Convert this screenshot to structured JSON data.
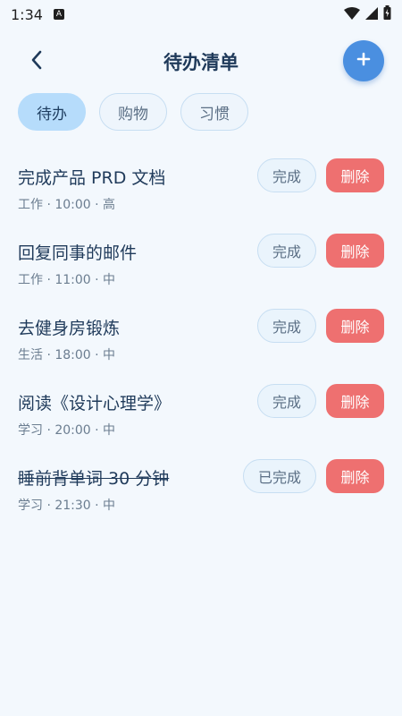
{
  "status_bar": {
    "time": "1:34",
    "notification_icon": "A"
  },
  "header": {
    "title": "待办清单",
    "back_icon": "chevron-left",
    "add_icon": "plus"
  },
  "tabs": [
    {
      "label": "待办",
      "active": true
    },
    {
      "label": "购物",
      "active": false
    },
    {
      "label": "习惯",
      "active": false
    }
  ],
  "tasks": [
    {
      "title": "完成产品 PRD 文档",
      "meta": "工作 · 10:00 · 高",
      "complete_label": "完成",
      "delete_label": "删除",
      "done": false
    },
    {
      "title": "回复同事的邮件",
      "meta": "工作 · 11:00 · 中",
      "complete_label": "完成",
      "delete_label": "删除",
      "done": false
    },
    {
      "title": "去健身房锻炼",
      "meta": "生活 · 18:00 · 中",
      "complete_label": "完成",
      "delete_label": "删除",
      "done": false
    },
    {
      "title": "阅读《设计心理学》",
      "meta": "学习 · 20:00 · 中",
      "complete_label": "完成",
      "delete_label": "删除",
      "done": false
    },
    {
      "title": "睡前背单词 30 分钟",
      "meta": "学习 · 21:30 · 中",
      "complete_label": "已完成",
      "delete_label": "删除",
      "done": true
    }
  ],
  "colors": {
    "background": "#f3f8fd",
    "accent": "#4a8fe0",
    "active_tab": "#b6dcfb",
    "delete": "#ee7070",
    "text": "#1f3a5a"
  }
}
